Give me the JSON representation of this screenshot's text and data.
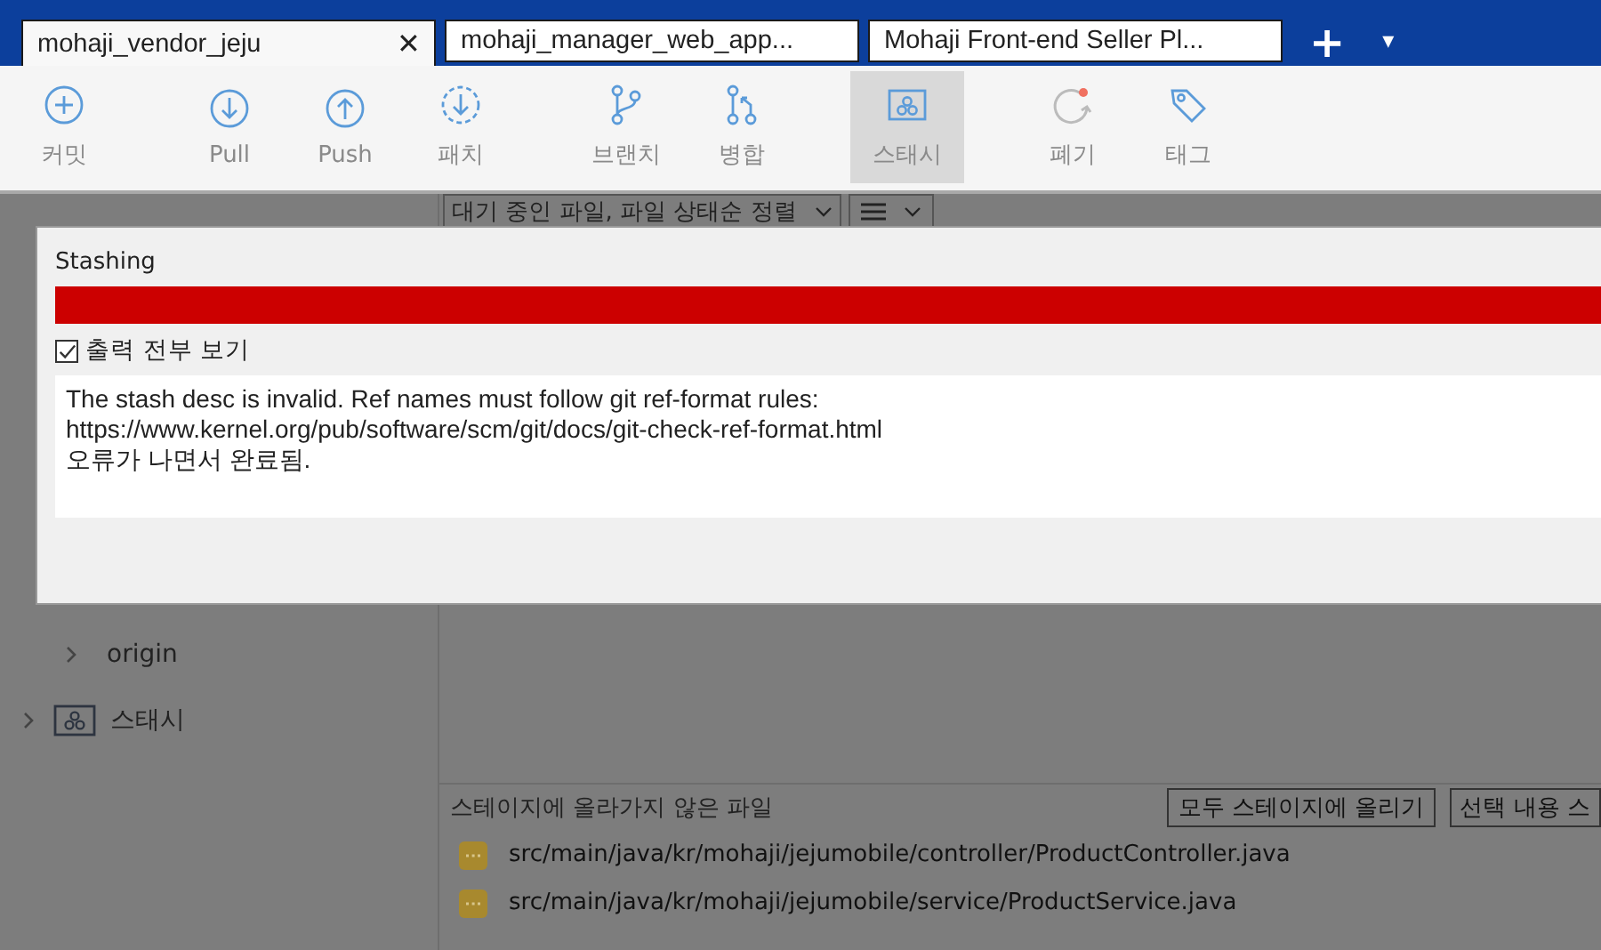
{
  "tabs": [
    {
      "label": "mohaji_vendor_jeju",
      "selected": true,
      "close": "✕"
    },
    {
      "label": "mohaji_manager_web_app...",
      "selected": false
    },
    {
      "label": "Mohaji Front-end Seller Pl...",
      "selected": false
    }
  ],
  "tab_actions": {
    "add": "+",
    "menu": "▾"
  },
  "toolbar": [
    [
      {
        "label": "커밋",
        "kind": "commit",
        "selected": false
      }
    ],
    [
      {
        "label": "Pull",
        "kind": "pull",
        "selected": false
      },
      {
        "label": "Push",
        "kind": "push",
        "selected": false
      },
      {
        "label": "패치",
        "kind": "patch",
        "selected": false
      }
    ],
    [
      {
        "label": "브랜치",
        "kind": "branch",
        "selected": false
      },
      {
        "label": "병합",
        "kind": "merge",
        "selected": false
      }
    ],
    [
      {
        "label": "스태시",
        "kind": "stash",
        "selected": true
      }
    ],
    [
      {
        "label": "폐기",
        "kind": "discard",
        "selected": false
      },
      {
        "label": "태그",
        "kind": "tag",
        "selected": false
      }
    ]
  ],
  "sidebar": {
    "items": [
      {
        "label": "origin",
        "kind": "remote",
        "expanded": false
      },
      {
        "label": "스태시",
        "kind": "stash",
        "expanded": false
      }
    ]
  },
  "file_view": {
    "sort_dropdown": "대기 중인 파일, 파일 상태순 정렬"
  },
  "unstaged": {
    "title": "스테이지에 올라가지 않은 파일",
    "buttons": [
      "모두 스테이지에 올리기",
      "선택 내용 스"
    ],
    "files": [
      "src/main/java/kr/mohaji/jejumobile/controller/ProductController.java",
      "src/main/java/kr/mohaji/jejumobile/service/ProductService.java"
    ]
  },
  "dialog": {
    "title": "Stashing",
    "progress": {
      "level": 1.0,
      "error": true
    },
    "show_output": {
      "label": "출력 전부 보기",
      "checked": true
    },
    "output": [
      "The stash desc is invalid. Ref names must follow git ref-format rules:",
      "https://www.kernel.org/pub/software/scm/git/docs/git-check-ref-format.html",
      "오류가 나면서 완료됨."
    ]
  }
}
